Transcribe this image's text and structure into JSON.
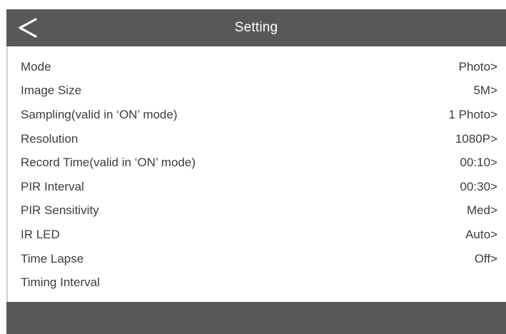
{
  "header": {
    "title": "Setting",
    "back_icon": "chevron-left-icon"
  },
  "settings": {
    "items": [
      {
        "label": "Mode",
        "value": "Photo>"
      },
      {
        "label": "Image Size",
        "value": "5M>"
      },
      {
        "label": "Sampling(valid in ‘ON’ mode)",
        "value": "1 Photo>"
      },
      {
        "label": "Resolution",
        "value": "1080P>"
      },
      {
        "label": "Record Time(valid in ‘ON’ mode)",
        "value": "00:10>"
      },
      {
        "label": "PIR Interval",
        "value": "00:30>"
      },
      {
        "label": "PIR Sensitivity",
        "value": "Med>"
      },
      {
        "label": "IR LED",
        "value": "Auto>"
      },
      {
        "label": "Time Lapse",
        "value": "Off>"
      },
      {
        "label": "Timing Interval",
        "value": ""
      }
    ]
  },
  "colors": {
    "bar": "#58585a",
    "text": "#3c3c3c",
    "background": "#ffffff"
  }
}
